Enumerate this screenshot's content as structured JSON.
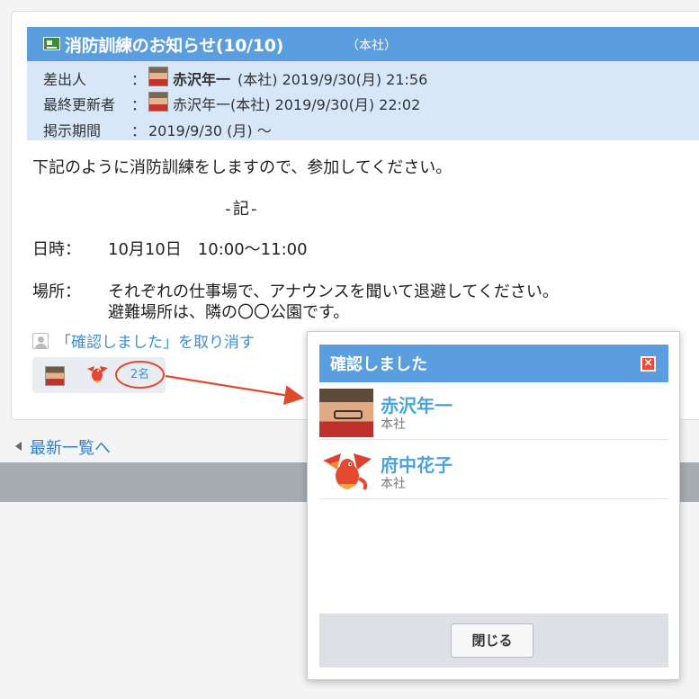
{
  "notice": {
    "title": "消防訓練のお知らせ(10/10)",
    "title_sub": "（本社）",
    "meta": [
      {
        "label": "差出人",
        "colon": "：",
        "name": "赤沢年一",
        "rest": "(本社) 2019/9/30(月) 21:56",
        "has_avatar": true
      },
      {
        "label": "最終更新者",
        "colon": "：",
        "name": "",
        "rest": "赤沢年一(本社) 2019/9/30(月) 22:02",
        "has_avatar": true
      },
      {
        "label": "掲示期間",
        "colon": "：",
        "name": "",
        "rest": "2019/9/30 (月) ～",
        "has_avatar": false
      }
    ],
    "body": {
      "intro": "下記のように消防訓練をしますので、参加してください。",
      "ki": "-記-",
      "date_label": "日時：",
      "date_value": "10月10日　10:00～11:00",
      "place_label": "場所：",
      "place_line1": "それぞれの仕事場で、アナウンスを聞いて退避してください。",
      "place_line2": "避難場所は、隣の〇〇公園です。"
    },
    "cancel_link": "「確認しました」を取り消す",
    "confirm_count": "2名"
  },
  "back_link": "最新一覧へ",
  "popup": {
    "title": "確認しました",
    "close_glyph": "×",
    "users": [
      {
        "name": "赤沢年一",
        "dept": "本社",
        "avatar": "photo-avatar"
      },
      {
        "name": "府中花子",
        "dept": "本社",
        "avatar": "dragon-avatar"
      }
    ],
    "close_button": "閉じる"
  },
  "colors": {
    "title_bar": "#5b9ee0",
    "header_band": "#d7e7f8",
    "link": "#3d8fd6",
    "badge_ring": "#e04a2c",
    "user_name": "#4aa3dd"
  }
}
